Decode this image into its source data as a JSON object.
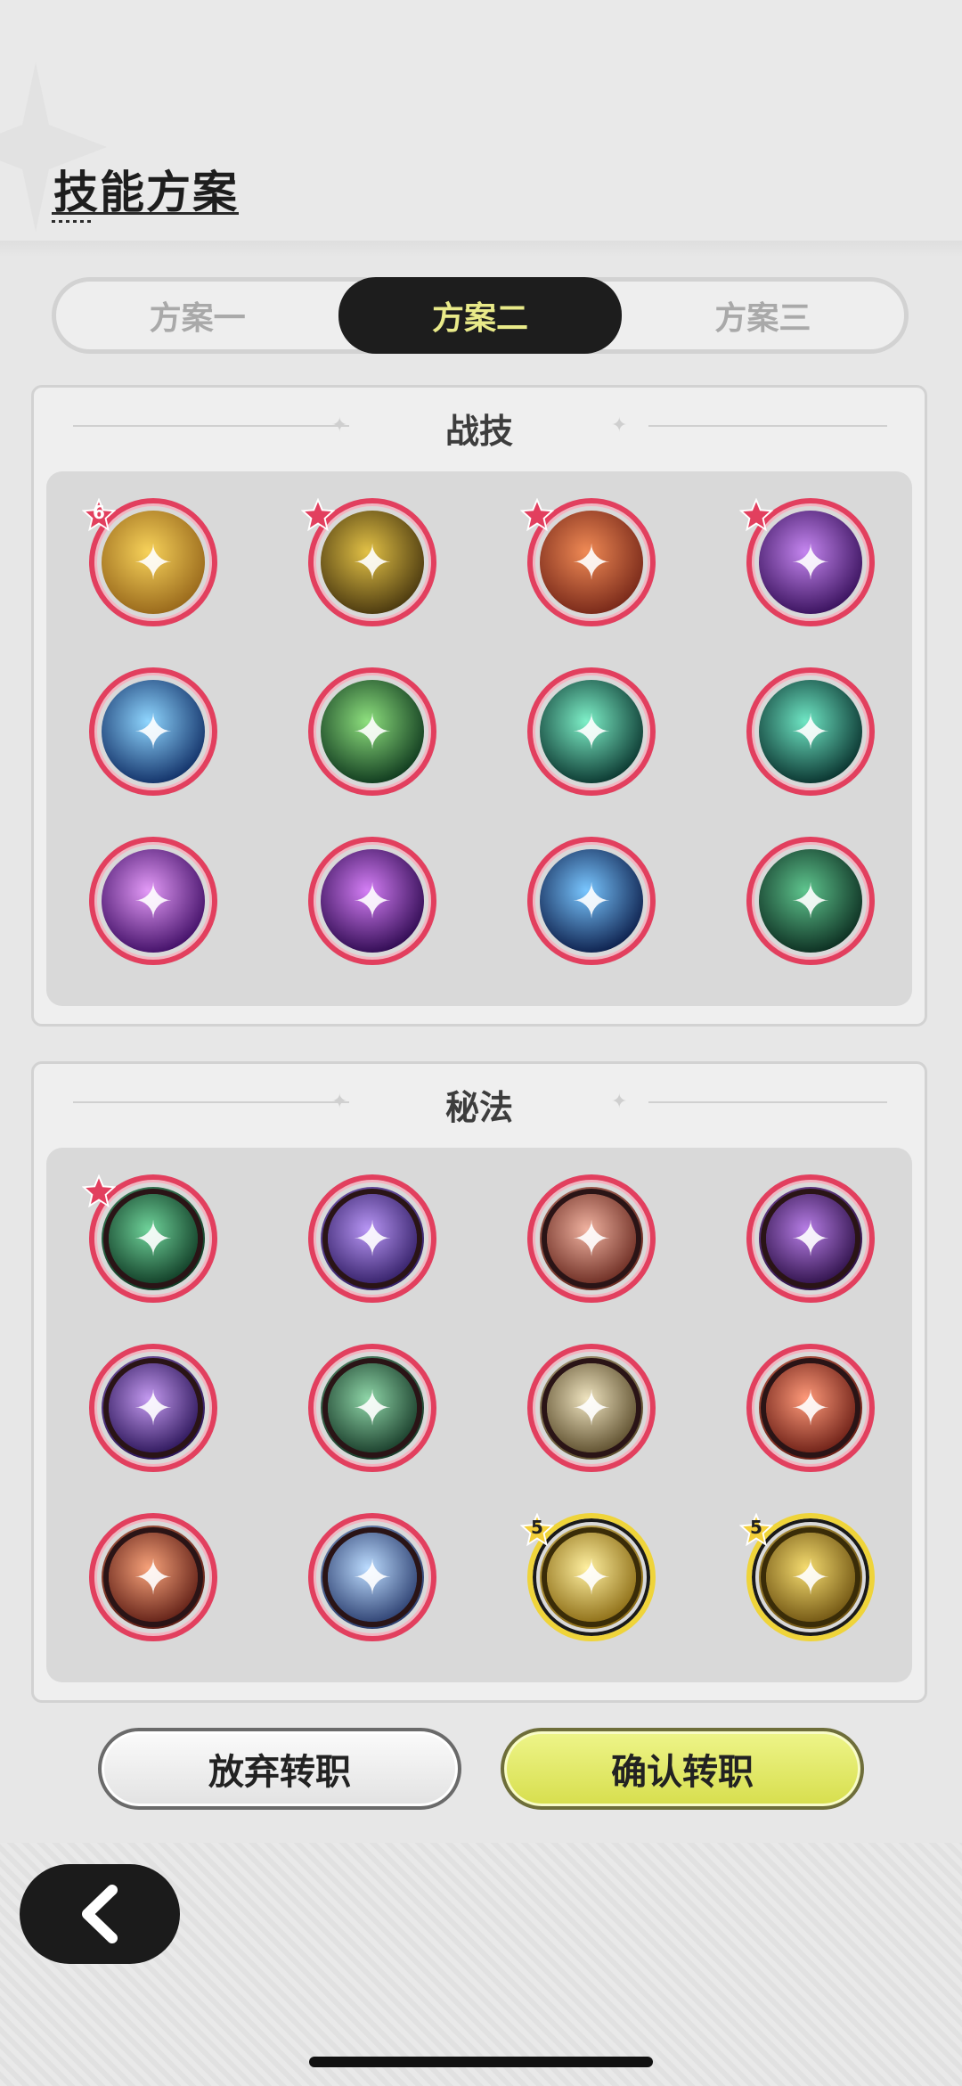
{
  "title": "技能方案",
  "tabs": [
    {
      "label": "方案一",
      "active": false
    },
    {
      "label": "方案二",
      "active": true
    },
    {
      "label": "方案三",
      "active": false
    }
  ],
  "combat_section": {
    "title": "战技",
    "skills": [
      {
        "icon": "golem-punch-icon",
        "badge": "6",
        "badge_type": "red-star",
        "colors": [
          "#f7d25a",
          "#9a6a1c"
        ]
      },
      {
        "icon": "golden-crystal-icon",
        "badge": "",
        "badge_type": "red-star",
        "colors": [
          "#e2c146",
          "#4d3b10"
        ]
      },
      {
        "icon": "fire-totem-icon",
        "badge": "",
        "badge_type": "red-star",
        "colors": [
          "#f08a55",
          "#7a2a1a"
        ]
      },
      {
        "icon": "shadow-demon-icon",
        "badge": "",
        "badge_type": "red-star",
        "colors": [
          "#c586f0",
          "#3c1460"
        ]
      },
      {
        "icon": "ice-burst-icon",
        "badge": "",
        "badge_type": "",
        "colors": [
          "#8fd6ff",
          "#14346b"
        ]
      },
      {
        "icon": "green-flame-icon",
        "badge": "",
        "badge_type": "",
        "colors": [
          "#8ee07e",
          "#123d20"
        ]
      },
      {
        "icon": "wind-blades-icon",
        "badge": "",
        "badge_type": "",
        "colors": [
          "#7ef0c8",
          "#0d3b33"
        ]
      },
      {
        "icon": "whirlwind-icon",
        "badge": "",
        "badge_type": "",
        "colors": [
          "#6fe6c4",
          "#0b3631"
        ]
      },
      {
        "icon": "arcane-star-icon",
        "badge": "",
        "badge_type": "",
        "colors": [
          "#e39af7",
          "#45126a"
        ]
      },
      {
        "icon": "arcane-diamond-icon",
        "badge": "",
        "badge_type": "",
        "colors": [
          "#d47ef5",
          "#330d55"
        ]
      },
      {
        "icon": "blue-flame-icon",
        "badge": "",
        "badge_type": "",
        "colors": [
          "#79c6ff",
          "#0f2350"
        ]
      },
      {
        "icon": "thorn-vine-icon",
        "badge": "",
        "badge_type": "",
        "colors": [
          "#5fc58e",
          "#0e3123"
        ]
      }
    ]
  },
  "arcane_section": {
    "title": "秘法",
    "skills": [
      {
        "icon": "winged-emblem-icon",
        "badge": "",
        "badge_type": "red-star",
        "gold": false,
        "colors": [
          "#6fd39a",
          "#0f3a24"
        ]
      },
      {
        "icon": "purple-fist-icon",
        "badge": "",
        "badge_type": "",
        "gold": false,
        "colors": [
          "#b896f5",
          "#321e66"
        ]
      },
      {
        "icon": "crimson-swirl-icon",
        "badge": "",
        "badge_type": "",
        "gold": false,
        "colors": [
          "#f0b2a0",
          "#6a2a20"
        ]
      },
      {
        "icon": "void-eye-icon",
        "badge": "",
        "badge_type": "",
        "gold": false,
        "colors": [
          "#b77ee6",
          "#2d1048"
        ]
      },
      {
        "icon": "dark-altar-icon",
        "badge": "",
        "badge_type": "",
        "gold": false,
        "colors": [
          "#c49af0",
          "#2a1458"
        ]
      },
      {
        "icon": "stone-guardian-icon",
        "badge": "",
        "badge_type": "",
        "gold": false,
        "colors": [
          "#8fd6a8",
          "#173a28"
        ]
      },
      {
        "icon": "rising-arrow-icon",
        "badge": "",
        "badge_type": "",
        "gold": false,
        "colors": [
          "#efe4c0",
          "#5a4b2a"
        ]
      },
      {
        "icon": "fire-spirit-icon",
        "badge": "",
        "badge_type": "",
        "gold": false,
        "colors": [
          "#ff9a7a",
          "#6a1d14"
        ]
      },
      {
        "icon": "flame-gauntlet-icon",
        "badge": "",
        "badge_type": "",
        "gold": false,
        "colors": [
          "#f7a27a",
          "#5e1d14"
        ]
      },
      {
        "icon": "blue-spark-icon",
        "badge": "",
        "badge_type": "",
        "gold": false,
        "colors": [
          "#bcdcff",
          "#2a3d6e"
        ]
      },
      {
        "icon": "golden-ascend-icon",
        "badge": "5",
        "badge_type": "gold-star",
        "gold": true,
        "colors": [
          "#fff0a0",
          "#8a6a12"
        ]
      },
      {
        "icon": "golden-beast-icon",
        "badge": "5",
        "badge_type": "gold-star",
        "gold": true,
        "colors": [
          "#f5dc70",
          "#6e5210"
        ]
      }
    ]
  },
  "buttons": {
    "abandon": "放弃转职",
    "confirm": "确认转职"
  },
  "back_icon": "back-chevron-icon"
}
